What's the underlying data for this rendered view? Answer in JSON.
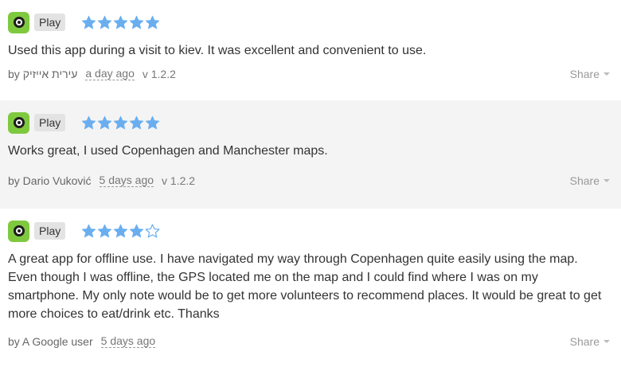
{
  "colors": {
    "star_fill": "#6aaef0",
    "star_outline": "#6aaef0",
    "app_icon": "#7fc93f",
    "alt_row": "#f4f4f4"
  },
  "reviews": [
    {
      "store": "Play",
      "rating": 5,
      "max_rating": 5,
      "text": "Used this app during a visit to kiev. It was excellent and convenient to use.",
      "author": "by עירית אייזיק",
      "date": "a day ago",
      "version": "v 1.2.2",
      "share": "Share"
    },
    {
      "store": "Play",
      "rating": 5,
      "max_rating": 5,
      "text": "Works great, I used Copenhagen and Manchester maps.",
      "author": "by Dario Vuković",
      "date": "5 days ago",
      "version": "v 1.2.2",
      "share": "Share"
    },
    {
      "store": "Play",
      "rating": 4,
      "max_rating": 5,
      "text": "A great app for offline use. I have navigated my way through Copenhagen quite easily using the map. Even though I was offline, the GPS located me on the map and I could find where I was on my smartphone. My only note would be to get more volunteers to recommend places. It would be great to get more choices to eat/drink etc. Thanks",
      "author": "by A Google user",
      "date": "5 days ago",
      "version": "",
      "share": "Share"
    }
  ]
}
